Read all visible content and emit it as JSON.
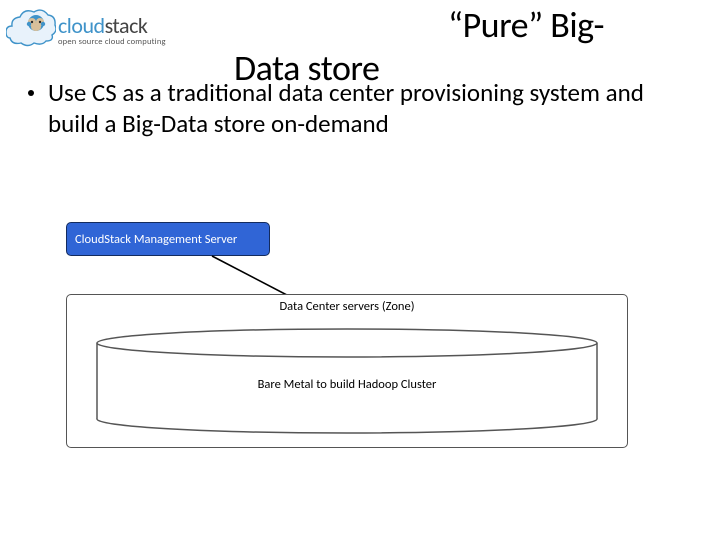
{
  "logo": {
    "brand_cloud": "cloud",
    "brand_stack": "stack",
    "tagline": "open source cloud computing"
  },
  "title": {
    "line1": "“Pure” Big-",
    "line2": "Data store"
  },
  "bullet": {
    "text": "Use CS as a traditional data center provisioning system and build a Big-Data store on-demand"
  },
  "diagram": {
    "mgmt_server": "CloudStack Management Server",
    "zone_label": "Data Center servers (Zone)",
    "cylinder_label": "Bare Metal to build Hadoop Cluster"
  }
}
